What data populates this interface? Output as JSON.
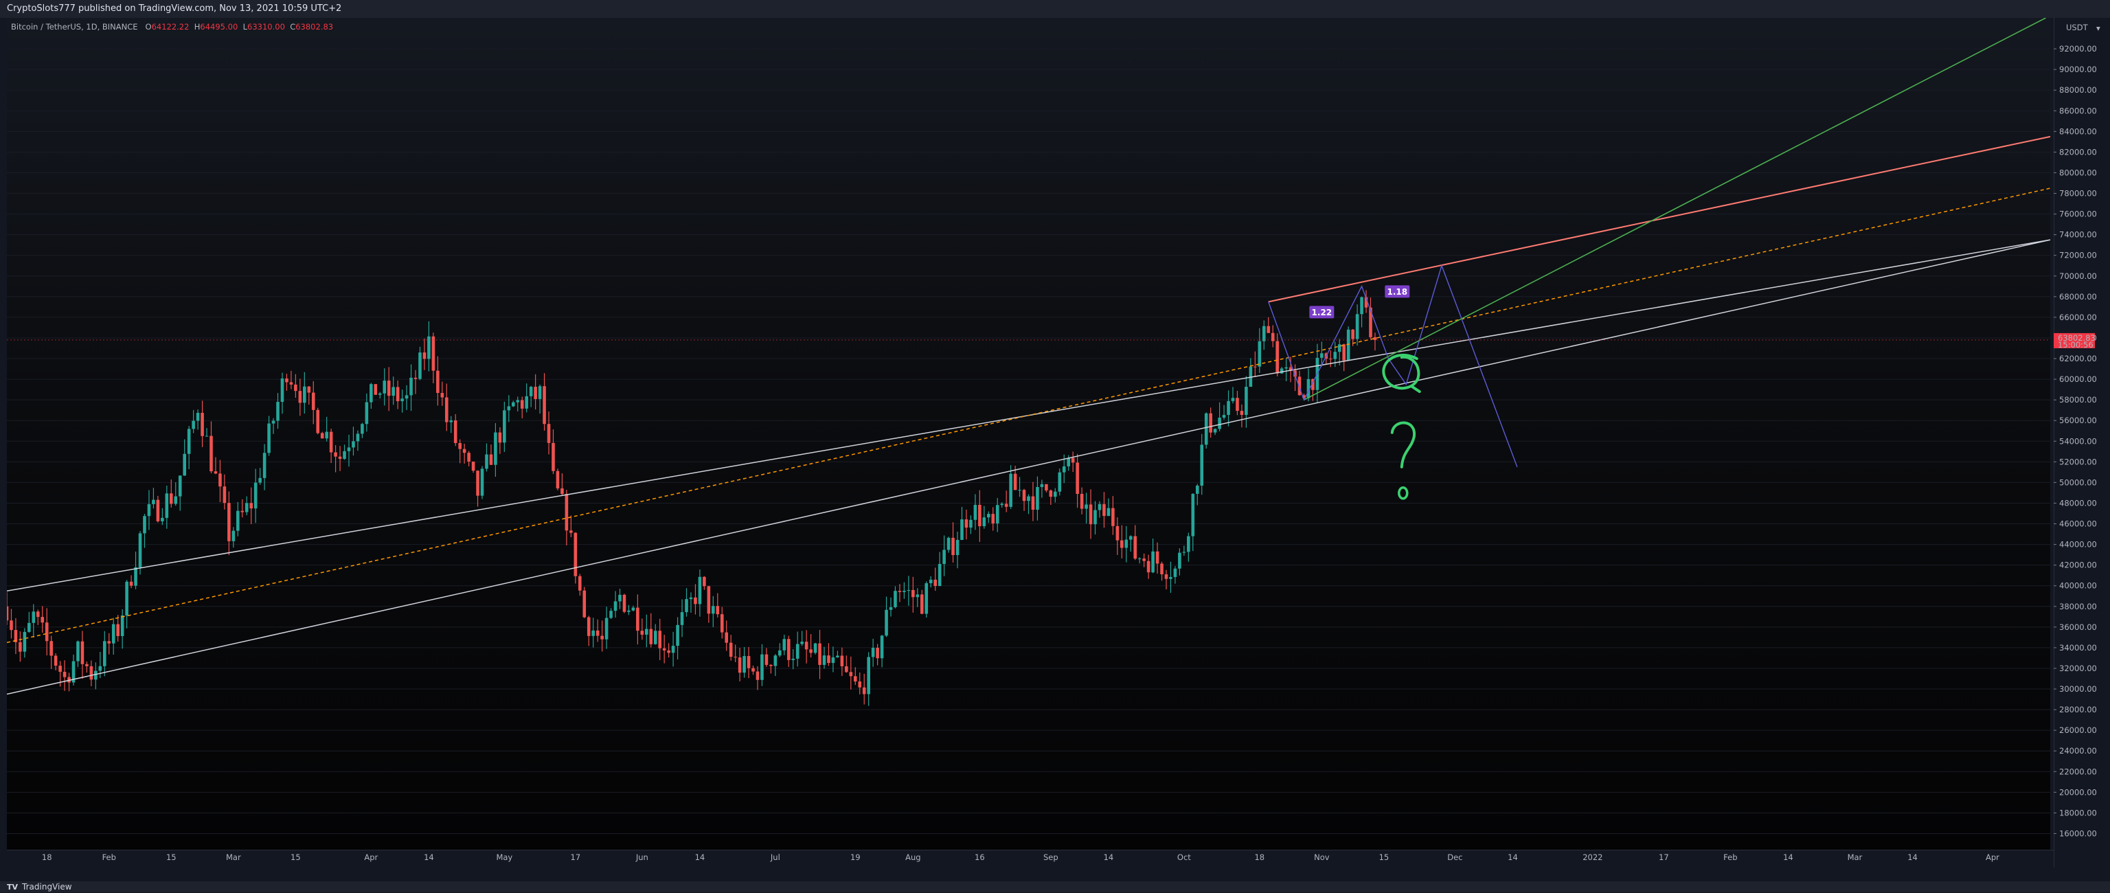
{
  "header": {
    "title": "CryptoSlots777 published on TradingView.com, Nov 13, 2021 10:59 UTC+2"
  },
  "legend": {
    "symbol": "Bitcoin / TetherUS, 1D, BINANCE",
    "open_label": "O",
    "open": "64122.22",
    "high_label": "H",
    "high": "64495.00",
    "low_label": "L",
    "low": "63310.00",
    "close_label": "C",
    "close": "63802.83"
  },
  "price_axis": {
    "currency": "USDT",
    "menu_icon": "chevron-down-icon",
    "last_price": "63802.83",
    "countdown": "15:00:56"
  },
  "footer": {
    "brand": "TradingView",
    "logo": "TV"
  },
  "colors": {
    "up": "#26a69a",
    "down": "#ef5350",
    "bg": "#131722",
    "channel": "#d1d4dc",
    "midline": "#ff9800",
    "resistance": "#ff7b72",
    "trend": "#4caf50",
    "projection": "#5c5bd6",
    "tag": "#7b3fc9",
    "price_tag": "#f23645"
  },
  "chart_data": {
    "type": "candlestick",
    "title": "Bitcoin / TetherUS, 1D, BINANCE",
    "ylim": [
      14500,
      95000
    ],
    "y_ticks": [
      16000,
      18000,
      20000,
      22000,
      24000,
      26000,
      28000,
      30000,
      32000,
      34000,
      36000,
      38000,
      40000,
      42000,
      44000,
      46000,
      48000,
      50000,
      52000,
      54000,
      56000,
      58000,
      60000,
      62000,
      64000,
      66000,
      68000,
      70000,
      72000,
      74000,
      76000,
      78000,
      80000,
      82000,
      84000,
      86000,
      88000,
      90000,
      92000
    ],
    "x_ticks": [
      {
        "date": "2021-01-18",
        "label": "18"
      },
      {
        "date": "2021-02-01",
        "label": "Feb"
      },
      {
        "date": "2021-02-15",
        "label": "15"
      },
      {
        "date": "2021-03-01",
        "label": "Mar"
      },
      {
        "date": "2021-03-15",
        "label": "15"
      },
      {
        "date": "2021-04-01",
        "label": "Apr"
      },
      {
        "date": "2021-04-14",
        "label": "14"
      },
      {
        "date": "2021-05-01",
        "label": "May"
      },
      {
        "date": "2021-05-17",
        "label": "17"
      },
      {
        "date": "2021-06-01",
        "label": "Jun"
      },
      {
        "date": "2021-06-14",
        "label": "14"
      },
      {
        "date": "2021-07-01",
        "label": "Jul"
      },
      {
        "date": "2021-07-19",
        "label": "19"
      },
      {
        "date": "2021-08-01",
        "label": "Aug"
      },
      {
        "date": "2021-08-16",
        "label": "16"
      },
      {
        "date": "2021-09-01",
        "label": "Sep"
      },
      {
        "date": "2021-09-14",
        "label": "14"
      },
      {
        "date": "2021-10-01",
        "label": "Oct"
      },
      {
        "date": "2021-10-18",
        "label": "18"
      },
      {
        "date": "2021-11-01",
        "label": "Nov"
      },
      {
        "date": "2021-11-15",
        "label": "15"
      },
      {
        "date": "2021-12-01",
        "label": "Dec"
      },
      {
        "date": "2021-12-14",
        "label": "14"
      },
      {
        "date": "2022-01-01",
        "label": "2022"
      },
      {
        "date": "2022-01-17",
        "label": "17"
      },
      {
        "date": "2022-02-01",
        "label": "Feb"
      },
      {
        "date": "2022-02-14",
        "label": "14"
      },
      {
        "date": "2022-03-01",
        "label": "Mar"
      },
      {
        "date": "2022-03-14",
        "label": "14"
      },
      {
        "date": "2022-04-01",
        "label": "Apr"
      }
    ],
    "x_range": [
      "2021-01-09",
      "2022-04-14"
    ],
    "price_path": [
      [
        "2021-01-09",
        38000
      ],
      [
        "2021-01-12",
        33500
      ],
      [
        "2021-01-15",
        37000
      ],
      [
        "2021-01-22",
        31000
      ],
      [
        "2021-01-25",
        33500
      ],
      [
        "2021-01-28",
        31500
      ],
      [
        "2021-02-03",
        35800
      ],
      [
        "2021-02-09",
        46500
      ],
      [
        "2021-02-16",
        49000
      ],
      [
        "2021-02-21",
        57500
      ],
      [
        "2021-02-28",
        45000
      ],
      [
        "2021-03-05",
        48000
      ],
      [
        "2021-03-13",
        61000
      ],
      [
        "2021-03-25",
        52500
      ],
      [
        "2021-04-02",
        59000
      ],
      [
        "2021-04-09",
        58000
      ],
      [
        "2021-04-14",
        63500
      ],
      [
        "2021-04-18",
        56000
      ],
      [
        "2021-04-25",
        49000
      ],
      [
        "2021-04-29",
        54000
      ],
      [
        "2021-05-03",
        57500
      ],
      [
        "2021-05-09",
        58500
      ],
      [
        "2021-05-12",
        50000
      ],
      [
        "2021-05-15",
        46500
      ],
      [
        "2021-05-19",
        37000
      ],
      [
        "2021-05-23",
        34500
      ],
      [
        "2021-05-27",
        39000
      ],
      [
        "2021-06-01",
        36500
      ],
      [
        "2021-06-07",
        34000
      ],
      [
        "2021-06-14",
        40000
      ],
      [
        "2021-06-22",
        32500
      ],
      [
        "2021-06-26",
        31500
      ],
      [
        "2021-07-02",
        34000
      ],
      [
        "2021-07-08",
        33500
      ],
      [
        "2021-07-15",
        32000
      ],
      [
        "2021-07-20",
        29800
      ],
      [
        "2021-07-24",
        33800
      ],
      [
        "2021-07-28",
        40000
      ],
      [
        "2021-08-03",
        38500
      ],
      [
        "2021-08-14",
        47500
      ],
      [
        "2021-08-19",
        45500
      ],
      [
        "2021-08-23",
        49500
      ],
      [
        "2021-08-29",
        48500
      ],
      [
        "2021-09-06",
        51800
      ],
      [
        "2021-09-08",
        46500
      ],
      [
        "2021-09-14",
        47000
      ],
      [
        "2021-09-20",
        43000
      ],
      [
        "2021-09-24",
        42500
      ],
      [
        "2021-09-29",
        41500
      ],
      [
        "2021-10-01",
        43800
      ],
      [
        "2021-10-06",
        55500
      ],
      [
        "2021-10-14",
        57500
      ],
      [
        "2021-10-20",
        65800
      ],
      [
        "2021-10-22",
        61500
      ],
      [
        "2021-10-27",
        58800
      ],
      [
        "2021-11-01",
        61300
      ],
      [
        "2021-11-07",
        63500
      ],
      [
        "2021-11-10",
        67000
      ],
      [
        "2021-11-13",
        63802.83
      ]
    ],
    "volatility": 1700,
    "annotations": {
      "channel_upper": [
        [
          "2021-01-09",
          39500
        ],
        [
          "2022-04-14",
          73500
        ]
      ],
      "channel_mid": [
        [
          "2021-01-09",
          34500
        ],
        [
          "2022-04-14",
          78500
        ]
      ],
      "channel_lower": [
        [
          "2021-01-09",
          29500
        ],
        [
          "2022-04-14",
          73500
        ]
      ],
      "resistance": [
        [
          "2021-10-20",
          67500
        ],
        [
          "2022-04-14",
          83500
        ]
      ],
      "trendline": [
        [
          "2021-10-28",
          58000
        ],
        [
          "2022-04-13",
          95000
        ]
      ],
      "projection_path": [
        [
          "2021-10-20",
          67500
        ],
        [
          "2021-10-28",
          58000
        ],
        [
          "2021-11-10",
          69000
        ],
        [
          "2021-11-16",
          62000
        ],
        [
          "2021-11-20",
          59500
        ],
        [
          "2021-11-28",
          71000
        ],
        [
          "2021-12-15",
          51500
        ]
      ],
      "ratio_tags": [
        {
          "label": "1.22",
          "date": "2021-11-01",
          "price": 66500
        },
        {
          "label": "1.18",
          "date": "2021-11-18",
          "price": 68500
        }
      ],
      "drawn_circle": {
        "date": "2021-11-19",
        "price": 60800
      },
      "drawn_question": {
        "date": "2021-11-19",
        "price": 53500
      }
    }
  }
}
